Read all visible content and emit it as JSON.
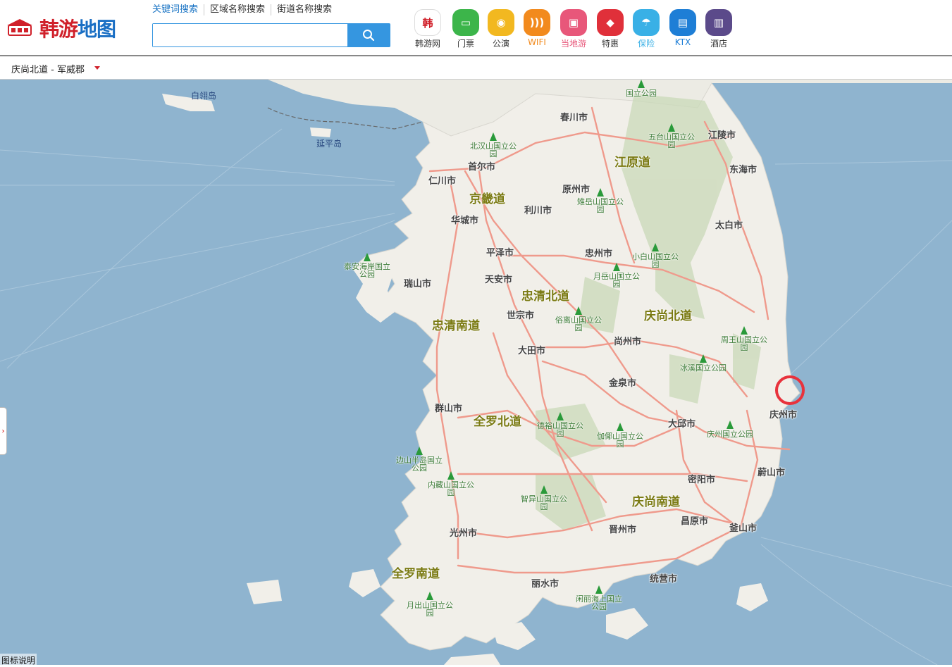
{
  "logo": {
    "badge": "韩游网",
    "name_a": "韩游",
    "name_b": "地图"
  },
  "search": {
    "tabs": [
      "关键词搜索",
      "区域名称搜索",
      "街道名称搜索"
    ],
    "placeholder": ""
  },
  "nav": [
    {
      "label": "韩游网",
      "icon": "hanyou-logo-icon",
      "color": "#ffffff",
      "text": "#333333"
    },
    {
      "label": "门票",
      "icon": "ticket-icon",
      "color": "#3cb54a",
      "text": "#333333"
    },
    {
      "label": "公演",
      "icon": "mask-icon",
      "color": "#f2b820",
      "text": "#333333"
    },
    {
      "label": "WIFI",
      "icon": "wifi-icon",
      "color": "#f28a1d",
      "text": "#f28a1d"
    },
    {
      "label": "当地游",
      "icon": "car-icon",
      "color": "#e8577a",
      "text": "#e8577a"
    },
    {
      "label": "特惠",
      "icon": "tag-icon",
      "color": "#e0303a",
      "text": "#333333"
    },
    {
      "label": "保险",
      "icon": "umbrella-icon",
      "color": "#39b0e6",
      "text": "#39b0e6"
    },
    {
      "label": "KTX",
      "icon": "train-icon",
      "color": "#1e7ed6",
      "text": "#1e7ed6"
    },
    {
      "label": "酒店",
      "icon": "hotel-icon",
      "color": "#5b4a8a",
      "text": "#333333"
    }
  ],
  "region": {
    "label": "庆尚北道 - 军威郡"
  },
  "map": {
    "provinces": [
      "江原道",
      "京畿道",
      "忠清北道",
      "庆尚北道",
      "忠清南道",
      "全罗北道",
      "庆尚南道",
      "全罗南道"
    ],
    "cities": [
      "春川市",
      "江陵市",
      "首尔市",
      "东海市",
      "仁川市",
      "原州市",
      "利川市",
      "华城市",
      "太白市",
      "平泽市",
      "忠州市",
      "天安市",
      "瑞山市",
      "世宗市",
      "大田市",
      "尚州市",
      "金泉市",
      "庆州市",
      "群山市",
      "大邱市",
      "蔚山市",
      "密阳市",
      "光州市",
      "晋州市",
      "昌原市",
      "釜山市",
      "丽水市",
      "统营市"
    ],
    "parks": [
      "北汉山国立公园",
      "五台山国立公园",
      "雉岳山国立公园",
      "小白山国立公园",
      "泰安海岸国立公园",
      "月岳山国立公园",
      "俗离山国立公园",
      "周王山国立公园",
      "冰溪国立公园",
      "德裕山国立公园",
      "伽倻山国立公园",
      "庆州国立公园",
      "边山半岛国立公园",
      "内藏山国立公园",
      "智异山国立公园",
      "月出山国立公园",
      "闲丽海上国立公园",
      "国立公园"
    ],
    "islands": [
      "白翎岛",
      "延平岛"
    ],
    "legend": "图标说明",
    "colors": {
      "sea": "#8fb4cf",
      "land": "#f1efe9",
      "road": "#ef9a8c",
      "mountain": "#c9d9b8",
      "marker": "#e8323c"
    }
  }
}
